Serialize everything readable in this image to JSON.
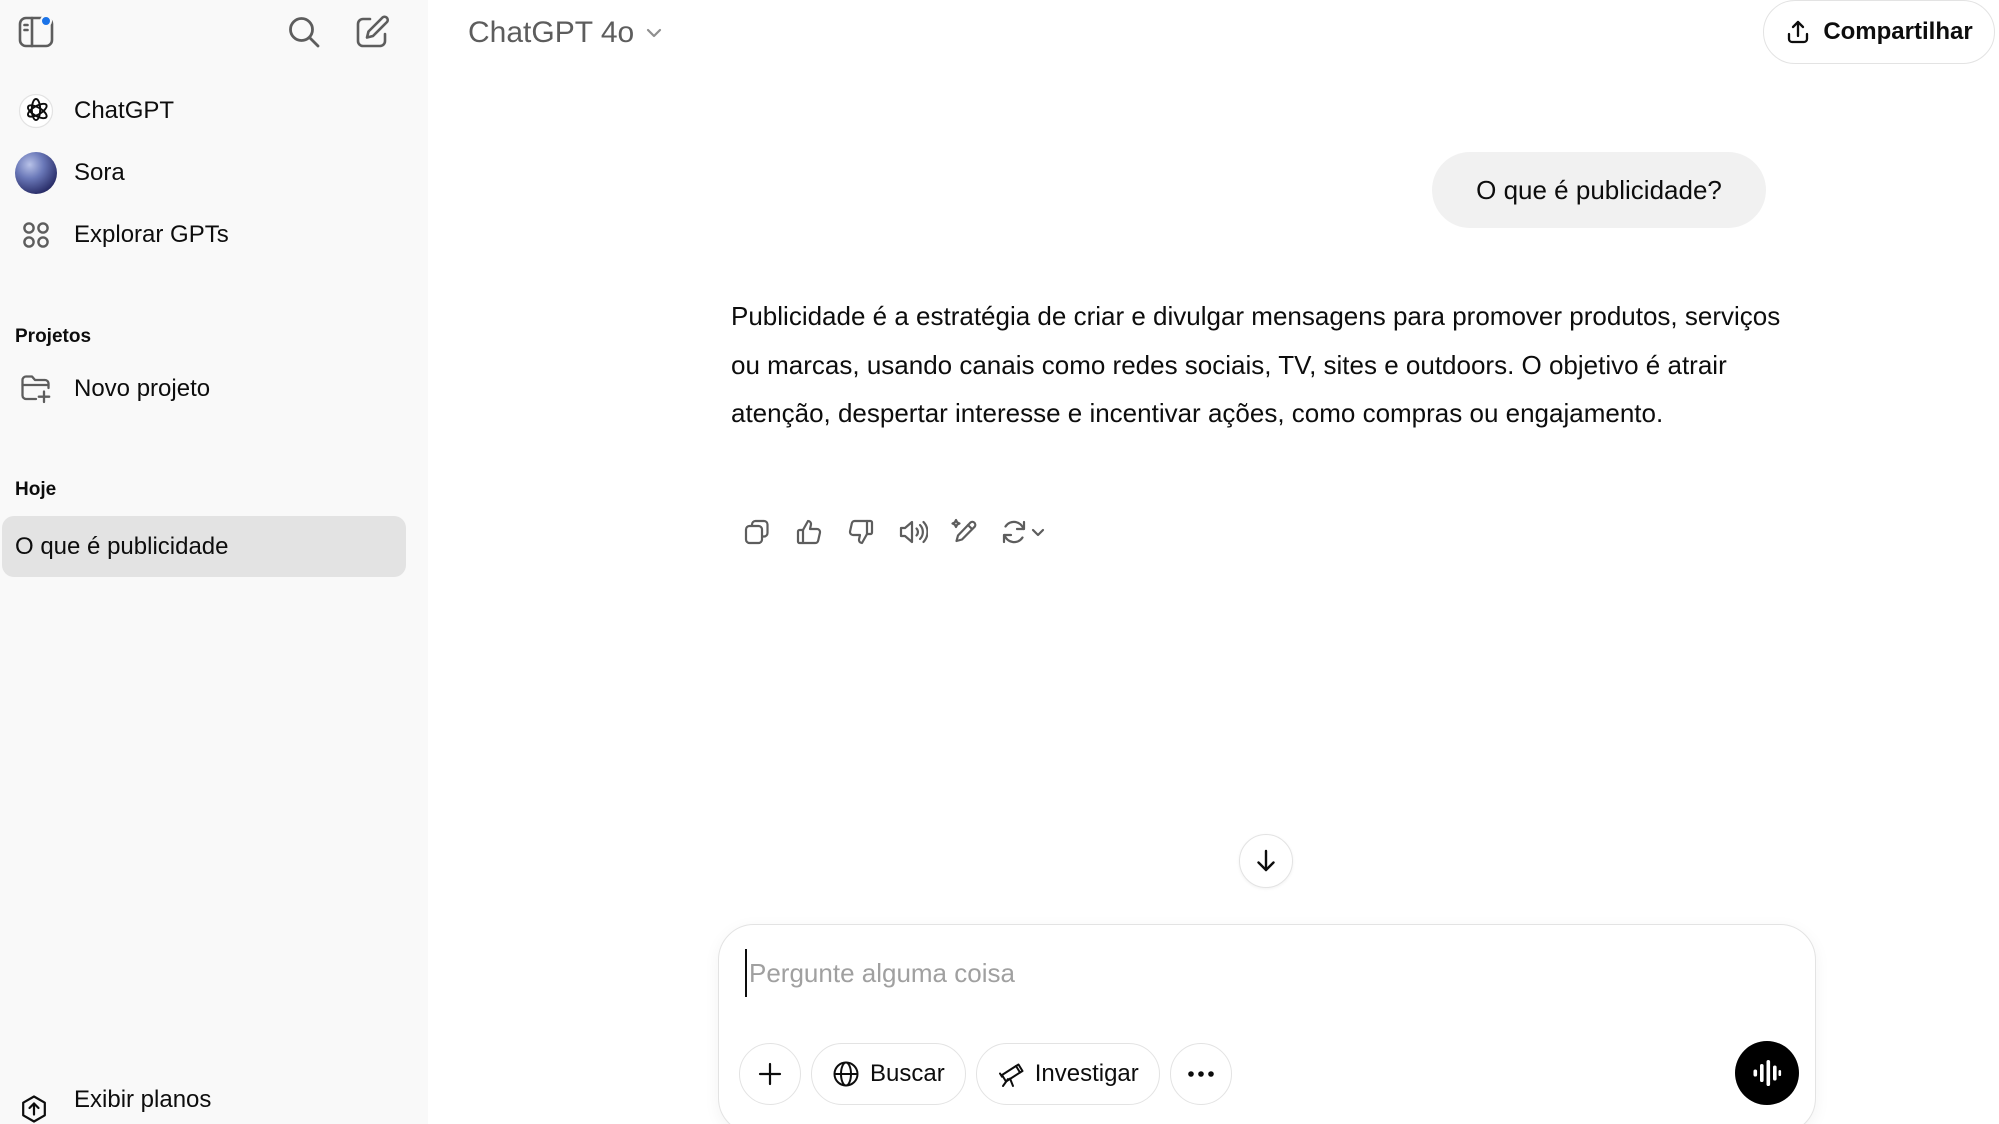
{
  "sidebar": {
    "items": [
      {
        "label": "ChatGPT",
        "icon": "chatgpt-logo-icon"
      },
      {
        "label": "Sora",
        "icon": "sora-avatar"
      },
      {
        "label": "Explorar GPTs",
        "icon": "grid-icon"
      }
    ],
    "projects": {
      "title": "Projetos",
      "new_project_label": "Novo projeto"
    },
    "history": {
      "section_title": "Hoje",
      "items": [
        {
          "label": "O que é publicidade",
          "active": true
        }
      ]
    },
    "plans_label": "Exibir planos",
    "notification_color": "#1a73e8"
  },
  "header": {
    "model_name": "ChatGPT 4o",
    "share_label": "Compartilhar"
  },
  "conversation": {
    "user_message": "O que é publicidade?",
    "assistant_message": "Publicidade é a estratégia de criar e divulgar mensagens para promover produtos, serviços ou marcas, usando canais como redes sociais, TV, sites e outdoors. O objetivo é atrair atenção, despertar interesse e incentivar ações, como compras ou engajamento.",
    "actions": [
      "copy-icon",
      "thumbs-up-icon",
      "thumbs-down-icon",
      "read-aloud-icon",
      "edit-canvas-icon",
      "regenerate-icon"
    ]
  },
  "composer": {
    "placeholder": "Pergunte alguma coisa",
    "value": "",
    "search_label": "Buscar",
    "research_label": "Investigar"
  }
}
